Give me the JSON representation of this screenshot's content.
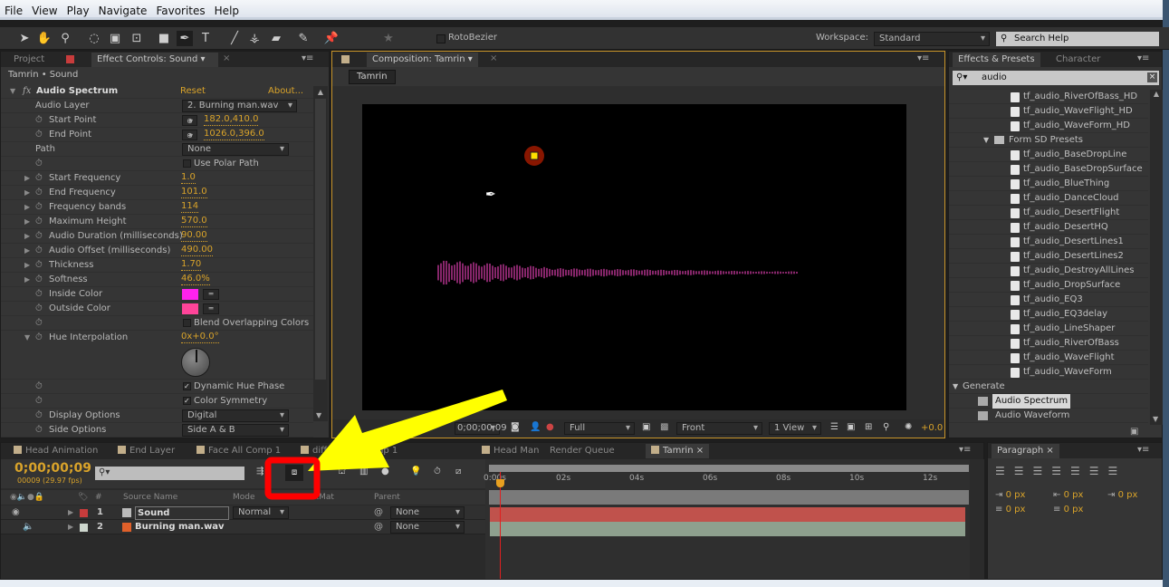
{
  "menu": [
    "File",
    "View",
    "Play",
    "Navigate",
    "Favorites",
    "Help"
  ],
  "toolbar": {
    "rotobezier": "RotoBezier",
    "workspace_label": "Workspace:",
    "workspace_value": "Standard",
    "search_help": "Search Help"
  },
  "left_panel": {
    "tabs": [
      "Project",
      "Effect Controls: Sound"
    ],
    "breadcrumb": "Tamrin • Sound",
    "effect": {
      "name": "Audio Spectrum",
      "reset": "Reset",
      "about": "About...",
      "audio_layer_label": "Audio Layer",
      "audio_layer": "2. Burning man.wav",
      "start_point_label": "Start Point",
      "start_point": "182.0,410.0",
      "end_point_label": "End Point",
      "end_point": "1026.0,396.0",
      "path_label": "Path",
      "path": "None",
      "polar": "Use Polar Path",
      "params": [
        {
          "label": "Start Frequency",
          "value": "1.0"
        },
        {
          "label": "End Frequency",
          "value": "101.0"
        },
        {
          "label": "Frequency bands",
          "value": "114"
        },
        {
          "label": "Maximum Height",
          "value": "570.0"
        },
        {
          "label": "Audio Duration (milliseconds)",
          "value": "90.00"
        },
        {
          "label": "Audio Offset (milliseconds)",
          "value": "490.00"
        },
        {
          "label": "Thickness",
          "value": "1.70"
        },
        {
          "label": "Softness",
          "value": "46.0%"
        }
      ],
      "inside_color_label": "Inside Color",
      "inside_color": "#ff22ee",
      "outside_color_label": "Outside Color",
      "outside_color": "#ff4499",
      "blend": "Blend Overlapping Colors",
      "hue_label": "Hue Interpolation",
      "hue": "0x+0.0°",
      "dynamic_hue": "Dynamic Hue Phase",
      "color_symmetry": "Color Symmetry",
      "display_label": "Display Options",
      "display": "Digital",
      "side_label": "Side Options",
      "side": "Side A & B"
    }
  },
  "comp_panel": {
    "tab": "Composition: Tamrin",
    "comp_button": "Tamrin",
    "timecode": "0;00;00;09",
    "resolution": "Full",
    "view": "Front",
    "views": "1 View",
    "exposure": "+0.0"
  },
  "effects_panel": {
    "tabs": [
      "Effects & Presets",
      "Character"
    ],
    "search": "audio",
    "items": [
      "tf_audio_RiverOfBass_HD",
      "tf_audio_WaveFlight_HD",
      "tf_audio_WaveForm_HD"
    ],
    "folder": "Form SD Presets",
    "sd_items": [
      "tf_audio_BaseDropLine",
      "tf_audio_BaseDropSurface",
      "tf_audio_BlueThing",
      "tf_audio_DanceCloud",
      "tf_audio_DesertFlight",
      "tf_audio_DesertHQ",
      "tf_audio_DesertLines1",
      "tf_audio_DesertLines2",
      "tf_audio_DestroyAllLines",
      "tf_audio_DropSurface",
      "tf_audio_EQ3",
      "tf_audio_EQ3delay",
      "tf_audio_LineShaper",
      "tf_audio_RiverOfBass",
      "tf_audio_WaveFlight",
      "tf_audio_WaveForm"
    ],
    "category": "Generate",
    "generate": [
      "Audio Spectrum",
      "Audio Waveform"
    ]
  },
  "timeline": {
    "tabs": [
      "Head Animation",
      "End Layer",
      "Face All Comp 1",
      "diffuse.jpg Comp 1",
      "Head Man",
      "Render Queue",
      "Tamrin"
    ],
    "timecode": "0;00;00;09",
    "fps": "00009 (29.97 fps)",
    "columns": {
      "num": "#",
      "source": "Source Name",
      "mode": "Mode",
      "trkmat": "TrkMat",
      "parent": "Parent"
    },
    "layers": [
      {
        "num": "1",
        "name": "Sound",
        "mode": "Normal",
        "parent": "None",
        "color": "#c83c3c"
      },
      {
        "num": "2",
        "name": "Burning man.wav",
        "parent": "None",
        "color": "#cfd8cf"
      }
    ],
    "ruler": [
      "0:00s",
      "02s",
      "04s",
      "06s",
      "08s",
      "10s",
      "12s"
    ]
  },
  "paragraph": {
    "tab": "Paragraph",
    "values": [
      "0 px",
      "0 px",
      "0 px",
      "0 px",
      "0 px"
    ]
  }
}
